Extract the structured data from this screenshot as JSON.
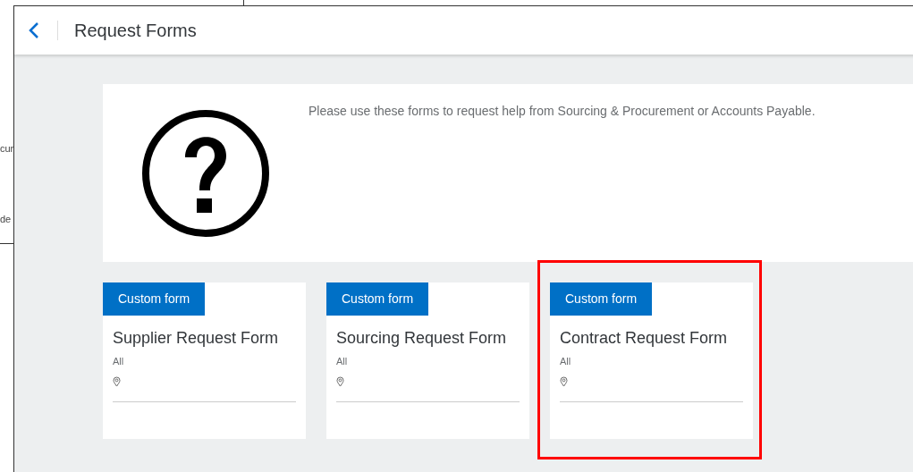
{
  "background_window": {
    "texts": [
      "cun",
      "de"
    ]
  },
  "window": {
    "title": "Request Forms"
  },
  "intro": {
    "text": "Please use these forms to request help from Sourcing & Procurement or Accounts Payable."
  },
  "cards": [
    {
      "badge": "Custom form",
      "title": "Supplier Request Form",
      "scope": "All",
      "highlighted": false
    },
    {
      "badge": "Custom form",
      "title": "Sourcing Request Form",
      "scope": "All",
      "highlighted": false
    },
    {
      "badge": "Custom form",
      "title": "Contract Request Form",
      "scope": "All",
      "highlighted": true
    }
  ]
}
